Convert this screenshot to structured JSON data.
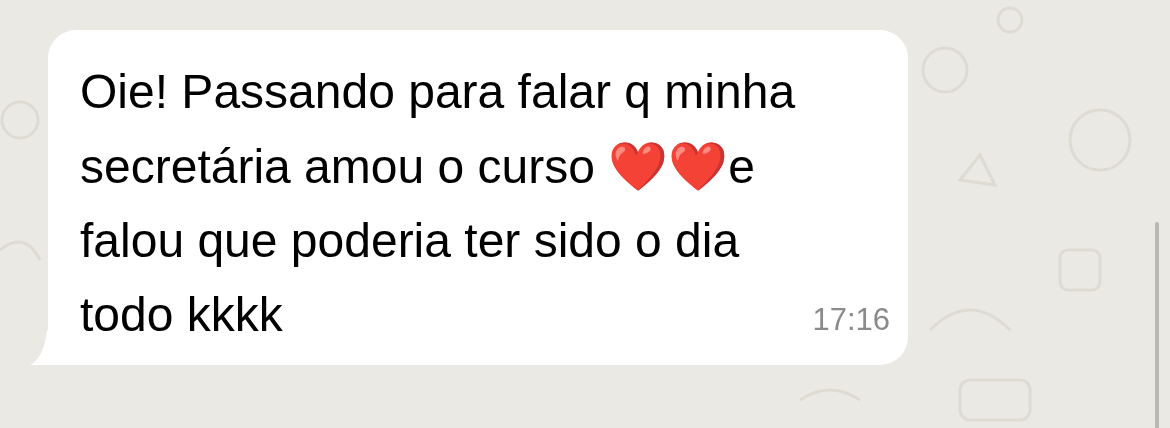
{
  "message": {
    "parts": [
      {
        "kind": "text",
        "text": "Oie! Passando para falar q minha secretária amou o curso "
      },
      {
        "kind": "emoji",
        "text": "❤️❤️"
      },
      {
        "kind": "text",
        "text": "e falou que poderia ter sido o dia todo kkkk"
      }
    ],
    "time": "17:16"
  }
}
